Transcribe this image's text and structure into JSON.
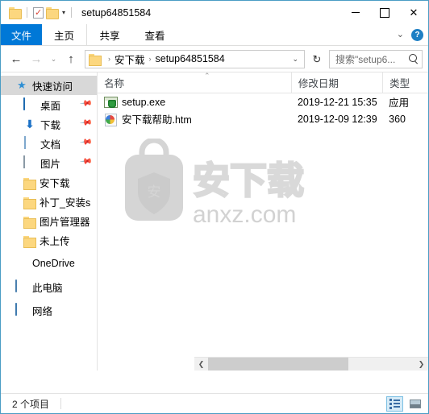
{
  "window": {
    "title": "setup64851584",
    "quick_access_toolbar": [
      {
        "name": "folder-icon",
        "label": "属性"
      },
      {
        "name": "properties-icon",
        "label": "属性"
      },
      {
        "name": "new-folder-icon",
        "label": "新建文件夹"
      },
      {
        "name": "customize-dropdown-icon",
        "label": "自定义快速访问工具栏"
      }
    ],
    "controls": {
      "minimize": "最小化",
      "maximize": "最大化",
      "close": "关闭",
      "close_glyph": "✕"
    }
  },
  "ribbon": {
    "tabs": [
      {
        "label": "文件",
        "active": true
      },
      {
        "label": "主页",
        "active": false
      },
      {
        "label": "共享",
        "active": false
      },
      {
        "label": "查看",
        "active": false
      }
    ],
    "expand_glyph": "⌄",
    "help_glyph": "?",
    "accent_color": "#0078d7"
  },
  "addressbar": {
    "back_glyph": "←",
    "forward_glyph": "→",
    "history_glyph": "⌄",
    "up_glyph": "↑",
    "crumbs": [
      "安下载",
      "setup64851584"
    ],
    "crumb_sep": "›",
    "dropdown_glyph": "⌄",
    "refresh_glyph": "↻"
  },
  "search": {
    "placeholder": "搜索\"setup6...",
    "icon": "search-icon"
  },
  "sidebar": {
    "items": [
      {
        "label": "快速访问",
        "icon": "star-icon",
        "selected": true,
        "pinned": false,
        "indent": false
      },
      {
        "label": "桌面",
        "icon": "desktop-icon",
        "selected": false,
        "pinned": true,
        "indent": true
      },
      {
        "label": "下载",
        "icon": "download-icon",
        "selected": false,
        "pinned": true,
        "indent": true
      },
      {
        "label": "文档",
        "icon": "document-icon",
        "selected": false,
        "pinned": true,
        "indent": true
      },
      {
        "label": "图片",
        "icon": "pictures-icon",
        "selected": false,
        "pinned": true,
        "indent": true
      },
      {
        "label": "安下载",
        "icon": "folder-icon",
        "selected": false,
        "pinned": false,
        "indent": true
      },
      {
        "label": "补丁_安装s",
        "icon": "folder-icon",
        "selected": false,
        "pinned": false,
        "indent": true
      },
      {
        "label": "图片管理器",
        "icon": "folder-icon",
        "selected": false,
        "pinned": false,
        "indent": true
      },
      {
        "label": "未上传",
        "icon": "folder-icon",
        "selected": false,
        "pinned": false,
        "indent": true
      },
      {
        "label": "OneDrive",
        "icon": "onedrive-icon",
        "selected": false,
        "pinned": false,
        "indent": false
      },
      {
        "label": "此电脑",
        "icon": "this-pc-icon",
        "selected": false,
        "pinned": false,
        "indent": false
      },
      {
        "label": "网络",
        "icon": "network-icon",
        "selected": false,
        "pinned": false,
        "indent": false
      }
    ]
  },
  "filelist": {
    "columns": [
      {
        "label": "名称",
        "key": "name"
      },
      {
        "label": "修改日期",
        "key": "date"
      },
      {
        "label": "类型",
        "key": "type"
      }
    ],
    "sort_caret": "⌃",
    "rows": [
      {
        "name": "setup.exe",
        "date": "2019-12-21 15:35",
        "type": "应用",
        "icon": "exe-file-icon"
      },
      {
        "name": "安下载帮助.htm",
        "date": "2019-12-09 12:39",
        "type": "360",
        "icon": "html-file-icon"
      }
    ]
  },
  "watermark": {
    "text_cn": "安下载",
    "text_domain": "anxz.com",
    "logo_char": "安",
    "color": "#d5d5d5"
  },
  "scrollbar": {
    "left_glyph": "❮",
    "right_glyph": "❯"
  },
  "statusbar": {
    "item_count": "2 个项目",
    "views": [
      {
        "name": "details-view-button",
        "label": "详细信息",
        "active": true
      },
      {
        "name": "large-icons-view-button",
        "label": "大图标",
        "active": false
      }
    ]
  }
}
